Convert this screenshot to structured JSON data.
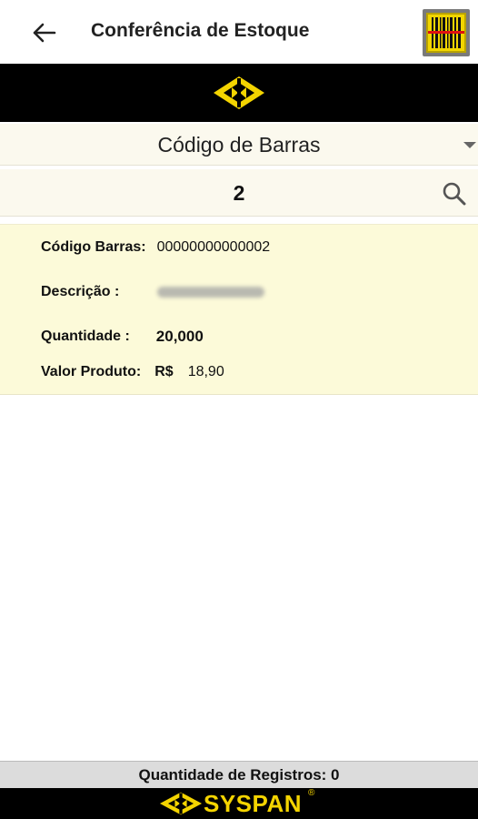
{
  "toolbar": {
    "title": "Conferência de Estoque"
  },
  "filter": {
    "selected": "Código de Barras"
  },
  "search": {
    "value": "2"
  },
  "product": {
    "barcode_label": "Código Barras:",
    "barcode_value": "00000000000002",
    "description_label": "Descrição :",
    "description_value": "",
    "quantity_label": "Quantidade :",
    "quantity_value": "20,000",
    "price_label": "Valor Produto:",
    "price_currency": "R$",
    "price_value": "18,90"
  },
  "footer": {
    "records_label": "Quantidade de Registros: 0",
    "brand": "SYSPAN",
    "brand_mark": "®"
  },
  "colors": {
    "brand_yellow": "#f4d400",
    "card_bg": "#fcfad9",
    "bar_bg": "#000000"
  },
  "icons": [
    "back-arrow-icon",
    "barcode-scan-icon",
    "syspan-logo-icon",
    "dropdown-caret-icon",
    "search-icon"
  ]
}
